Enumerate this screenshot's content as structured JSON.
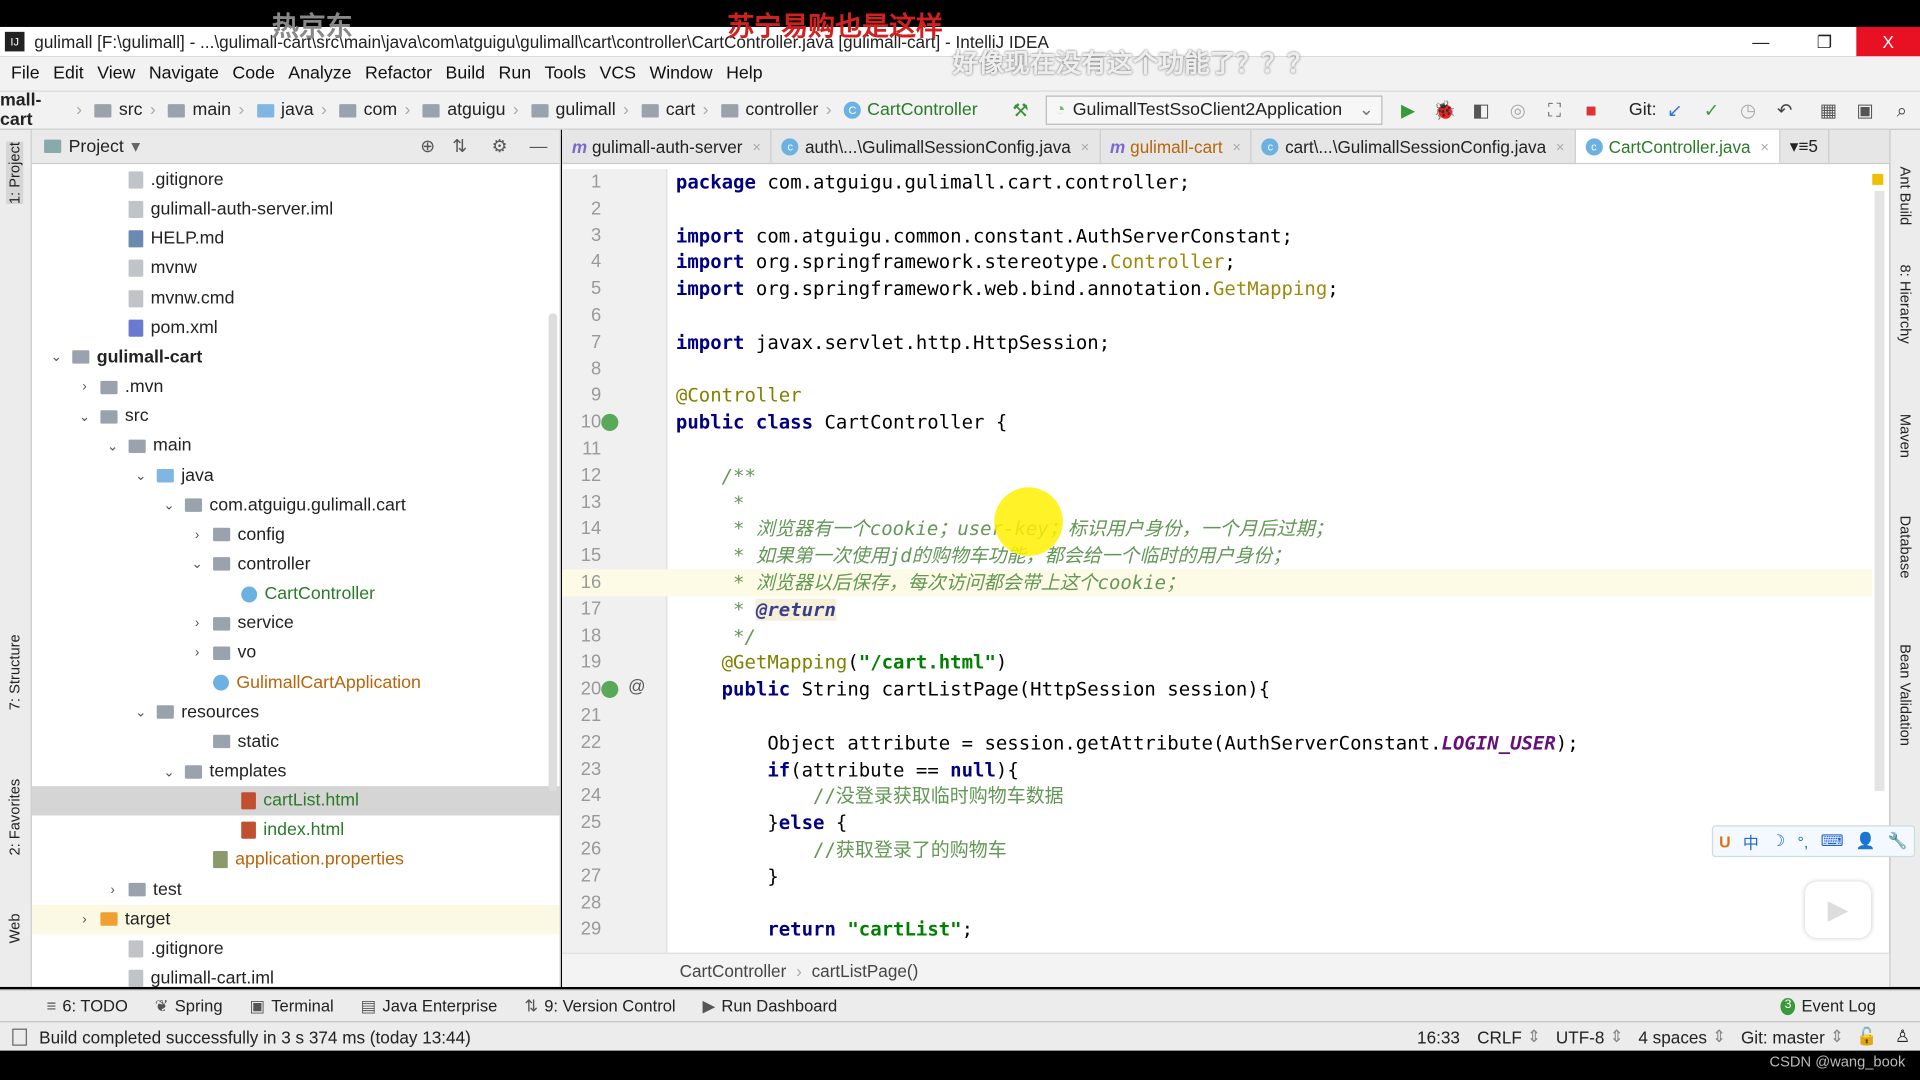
{
  "overlays": {
    "top_left": "热京东",
    "top_red": "苏宁易购也是这样",
    "subtitle": "好像现在没有这个功能了？？？"
  },
  "window": {
    "title": "gulimall [F:\\gulimall] - ...\\gulimall-cart\\src\\main\\java\\com\\atguigu\\gulimall\\cart\\controller\\CartController.java [gulimall-cart] - IntelliJ IDEA",
    "minimize": "—",
    "restore": "❐",
    "close": "X"
  },
  "menu": [
    "File",
    "Edit",
    "View",
    "Navigate",
    "Code",
    "Analyze",
    "Refactor",
    "Build",
    "Run",
    "Tools",
    "VCS",
    "Window",
    "Help"
  ],
  "breadcrumb": [
    "mall-cart",
    "src",
    "main",
    "java",
    "com",
    "atguigu",
    "gulimall",
    "cart",
    "controller",
    "CartController"
  ],
  "toolbar": {
    "run_config": "GulimallTestSsoClient2Application",
    "git_label": "Git:"
  },
  "left_strip": {
    "project": "1: Project",
    "structure": "7: Structure",
    "favorites": "2: Favorites",
    "web": "Web"
  },
  "right_strip": [
    "Ant Build",
    "8: Hierarchy",
    "Maven",
    "Database",
    "Bean Validation"
  ],
  "project_panel": {
    "title": "Project",
    "tree": [
      {
        "label": ".gitignore",
        "depth": 3,
        "icon": "file"
      },
      {
        "label": "gulimall-auth-server.iml",
        "depth": 3,
        "icon": "file"
      },
      {
        "label": "HELP.md",
        "depth": 3,
        "icon": "md"
      },
      {
        "label": "mvnw",
        "depth": 3,
        "icon": "file"
      },
      {
        "label": "mvnw.cmd",
        "depth": 3,
        "icon": "file"
      },
      {
        "label": "pom.xml",
        "depth": 3,
        "icon": "maven"
      },
      {
        "label": "gulimall-cart",
        "depth": 1,
        "icon": "module",
        "arrow": "open",
        "bold": true
      },
      {
        "label": ".mvn",
        "depth": 2,
        "icon": "folder",
        "arrow": "closed"
      },
      {
        "label": "src",
        "depth": 2,
        "icon": "folder",
        "arrow": "open"
      },
      {
        "label": "main",
        "depth": 3,
        "icon": "folder",
        "arrow": "open"
      },
      {
        "label": "java",
        "depth": 4,
        "icon": "folder-blue",
        "arrow": "open"
      },
      {
        "label": "com.atguigu.gulimall.cart",
        "depth": 5,
        "icon": "folder",
        "arrow": "open"
      },
      {
        "label": "config",
        "depth": 6,
        "icon": "folder",
        "arrow": "closed"
      },
      {
        "label": "controller",
        "depth": 6,
        "icon": "folder",
        "arrow": "open"
      },
      {
        "label": "CartController",
        "depth": 7,
        "icon": "class",
        "color": "green"
      },
      {
        "label": "service",
        "depth": 6,
        "icon": "folder",
        "arrow": "closed"
      },
      {
        "label": "vo",
        "depth": 6,
        "icon": "folder",
        "arrow": "closed"
      },
      {
        "label": "GulimallCartApplication",
        "depth": 6,
        "icon": "spring-class",
        "color": "orange"
      },
      {
        "label": "resources",
        "depth": 4,
        "icon": "folder",
        "arrow": "open"
      },
      {
        "label": "static",
        "depth": 6,
        "icon": "folder"
      },
      {
        "label": "templates",
        "depth": 5,
        "icon": "folder",
        "arrow": "open"
      },
      {
        "label": "cartList.html",
        "depth": 7,
        "icon": "html",
        "color": "green",
        "selected": true
      },
      {
        "label": "index.html",
        "depth": 7,
        "icon": "html",
        "color": "green"
      },
      {
        "label": "application.properties",
        "depth": 6,
        "icon": "properties",
        "color": "orange"
      },
      {
        "label": "test",
        "depth": 3,
        "icon": "folder",
        "arrow": "closed"
      },
      {
        "label": "target",
        "depth": 2,
        "icon": "folder-orange",
        "arrow": "closed",
        "highlight": true
      },
      {
        "label": ".gitignore",
        "depth": 3,
        "icon": "file"
      },
      {
        "label": "gulimall-cart.iml",
        "depth": 3,
        "icon": "file"
      }
    ]
  },
  "tabs": [
    {
      "label": "gulimall-auth-server",
      "icon": "maven"
    },
    {
      "label": "auth\\...\\GulimallSessionConfig.java",
      "icon": "class"
    },
    {
      "label": "gulimall-cart",
      "icon": "maven"
    },
    {
      "label": "cart\\...\\GulimallSessionConfig.java",
      "icon": "class"
    },
    {
      "label": "CartController.java",
      "icon": "class",
      "active": true
    }
  ],
  "tabs_overflow": "▾≡5",
  "code": {
    "current_line": 16,
    "lines": [
      [
        [
          "package",
          "kw"
        ],
        [
          " com.atguigu.gulimall.cart.controller;",
          ""
        ]
      ],
      [],
      [
        [
          "import",
          "kw"
        ],
        [
          " com.atguigu.common.constant.AuthServerConstant;",
          ""
        ]
      ],
      [
        [
          "import",
          "kw"
        ],
        [
          " org.springframework.stereotype.",
          ""
        ],
        [
          "Controller",
          "yel"
        ],
        [
          ";",
          ""
        ]
      ],
      [
        [
          "import",
          "kw"
        ],
        [
          " org.springframework.web.bind.annotation.",
          ""
        ],
        [
          "GetMapping",
          "yel"
        ],
        [
          ";",
          ""
        ]
      ],
      [],
      [
        [
          "import",
          "kw"
        ],
        [
          " javax.servlet.http.HttpSession;",
          ""
        ]
      ],
      [],
      [
        [
          "@Controller",
          "ann"
        ]
      ],
      [
        [
          "public class",
          "kw"
        ],
        [
          " CartController {",
          ""
        ]
      ],
      [],
      [
        [
          "    /**",
          "doc"
        ]
      ],
      [
        [
          "     *",
          "doc"
        ]
      ],
      [
        [
          "     * 浏览器有一个cookie；user-key；标识用户身份，一个月后过期；",
          "doc"
        ]
      ],
      [
        [
          "     * 如果第一次使用jd的购物车功能，都会给一个临时的用户身份；",
          "doc"
        ]
      ],
      [
        [
          "     * 浏览器以后保存，每次访问都会带上这个cookie；",
          "doc"
        ]
      ],
      [
        [
          "     * ",
          "doc"
        ],
        [
          "@return",
          "docb"
        ]
      ],
      [
        [
          "     */",
          "doc"
        ]
      ],
      [
        [
          "    @GetMapping",
          "ann"
        ],
        [
          "(",
          ""
        ],
        [
          "\"/cart.html\"",
          "str"
        ],
        [
          ")",
          ""
        ]
      ],
      [
        [
          "    public",
          "kw"
        ],
        [
          " String cartListPage(HttpSession session){",
          ""
        ]
      ],
      [],
      [
        [
          "        Object attribute = session.getAttribute(AuthServerConstant.",
          ""
        ],
        [
          "LOGIN_USER",
          "const"
        ],
        [
          ");",
          ""
        ]
      ],
      [
        [
          "        if",
          "kw"
        ],
        [
          "(attribute == ",
          ""
        ],
        [
          "null",
          "kw"
        ],
        [
          "){",
          ""
        ]
      ],
      [
        [
          "            //没登录获取临时购物车数据",
          "cmt"
        ]
      ],
      [
        [
          "        }",
          ""
        ],
        [
          "else",
          "kw"
        ],
        [
          " {",
          ""
        ]
      ],
      [
        [
          "            //获取登录了的购物车",
          "cmt"
        ]
      ],
      [
        [
          "        }",
          ""
        ]
      ],
      [],
      [
        [
          "        return",
          "kw"
        ],
        [
          " ",
          ""
        ],
        [
          "\"cartList\"",
          "str"
        ],
        [
          ";",
          ""
        ]
      ]
    ]
  },
  "editor_breadcrumb": [
    "CartController",
    "cartListPage()"
  ],
  "tool_windows": [
    "6: TODO",
    "Spring",
    "Terminal",
    "Java Enterprise",
    "9: Version Control",
    "Run Dashboard"
  ],
  "event_log": "Event Log",
  "status": {
    "message": "Build completed successfully in 3 s 374 ms (today 13:44)",
    "position": "16:33",
    "line_sep": "CRLF",
    "encoding": "UTF-8",
    "indent": "4 spaces",
    "git": "Git: master"
  },
  "ime": [
    "中",
    "☽",
    "°,",
    "⌨",
    "👤",
    "🔧"
  ],
  "watermark": "CSDN @wang_book",
  "colors": {
    "keyword": "#000080",
    "annotation": "#808000",
    "doc_comment": "#629755",
    "string": "#008000",
    "close_button": "#e81123"
  }
}
